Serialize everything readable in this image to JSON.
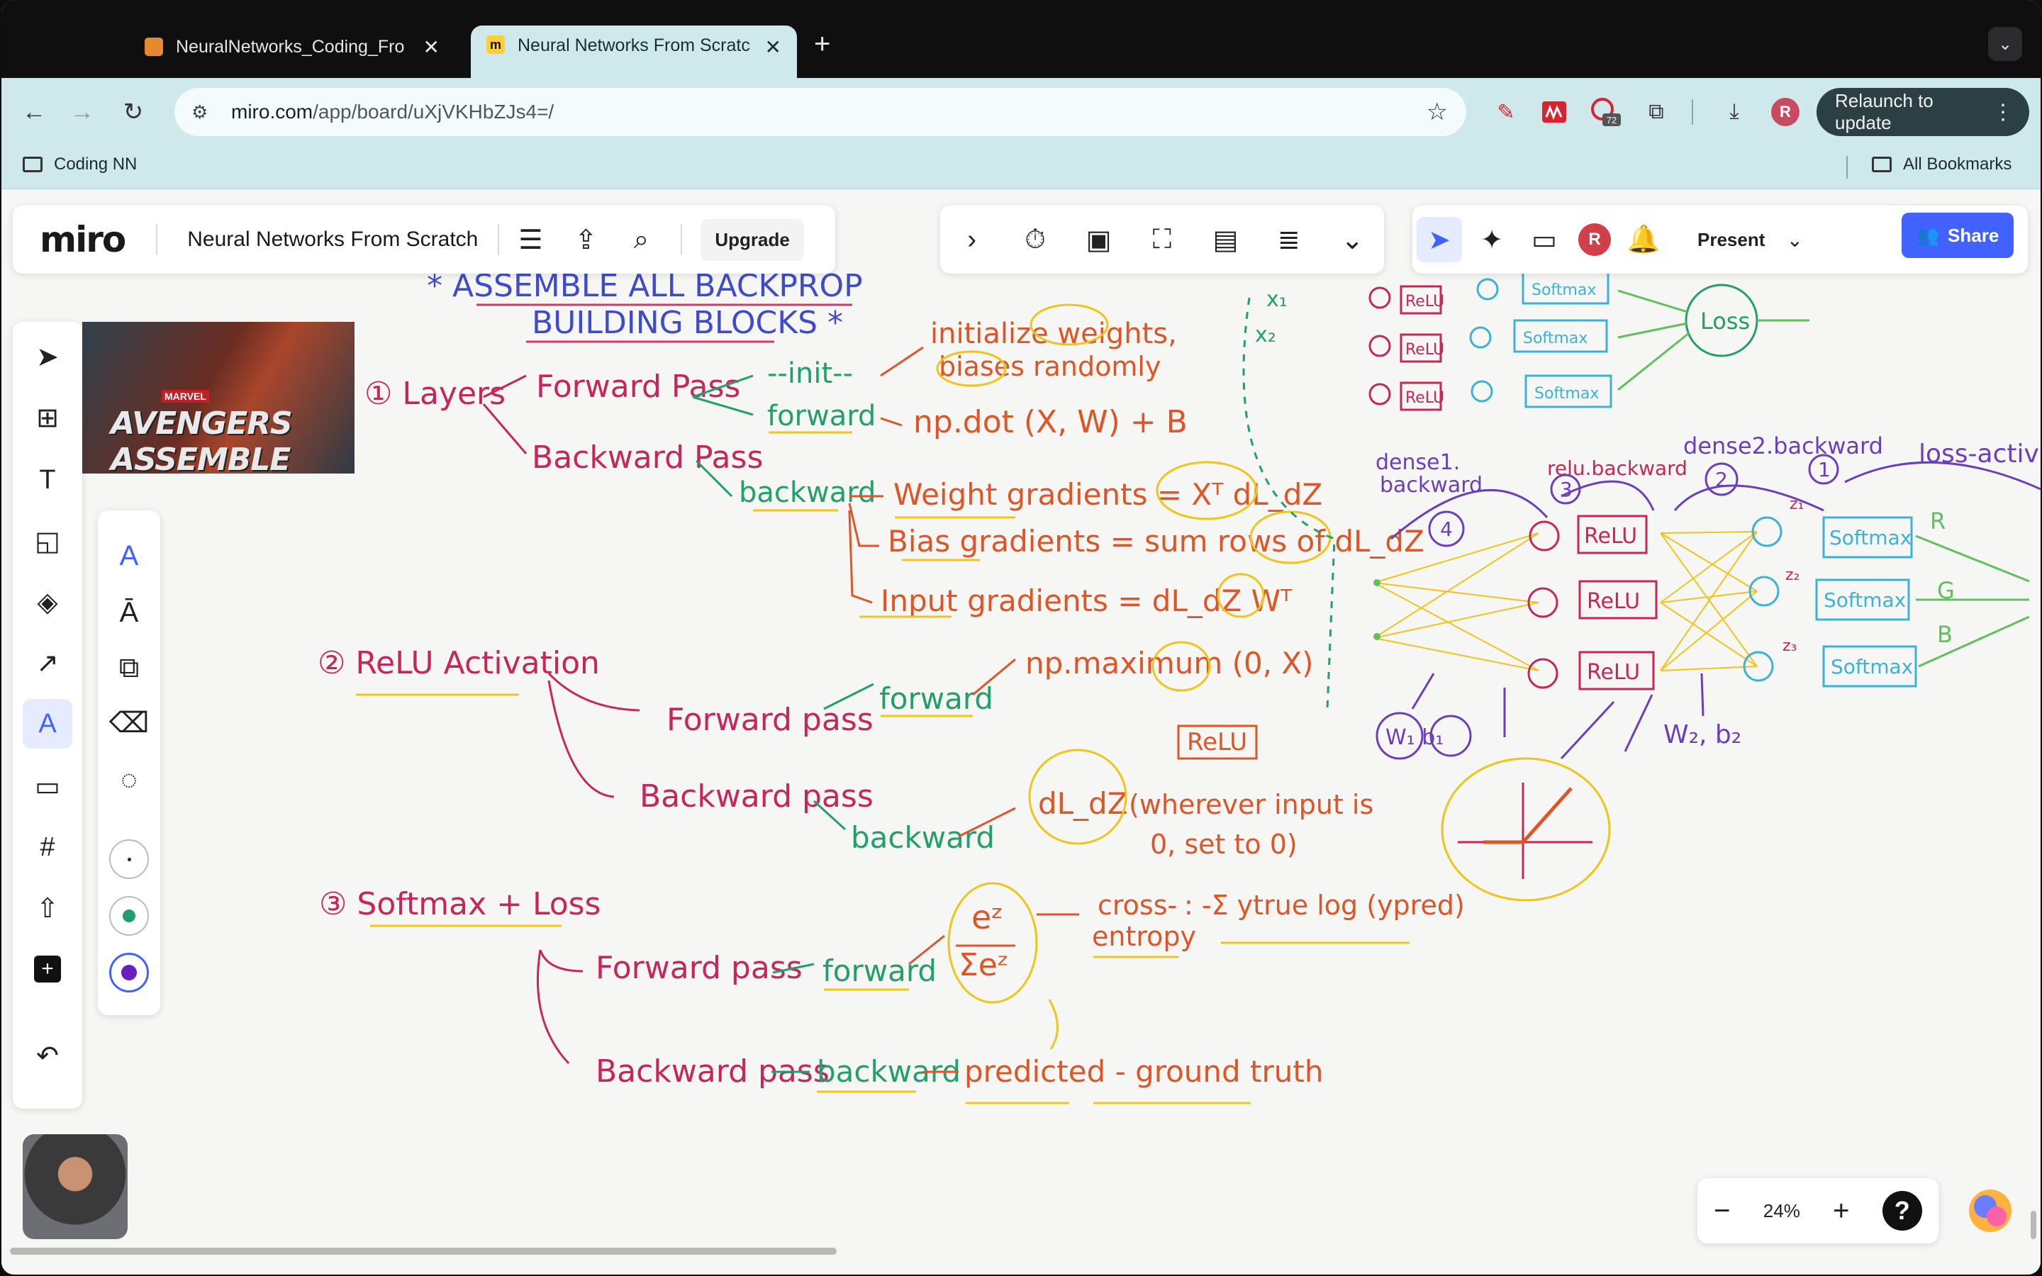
{
  "browser": {
    "tabs": [
      {
        "title": "NeuralNetworks_Coding_Fro",
        "active": false
      },
      {
        "title": "Neural Networks From Scratc",
        "active": true
      }
    ],
    "url_host": "miro.com",
    "url_path": "/app/board/uXjVKHbZJs4=/",
    "extension_badge": "72",
    "profile_initial": "R",
    "relaunch_label": "Relaunch to update",
    "bookmarks": {
      "left": "Coding NN",
      "right": "All Bookmarks"
    }
  },
  "miro": {
    "logo": "miro",
    "board_title": "Neural Networks From Scratch",
    "upgrade_label": "Upgrade",
    "present_label": "Present",
    "share_label": "Share",
    "user_initial": "R",
    "zoom_level": "24%",
    "thumbnail": {
      "badge": "MARVEL",
      "title": "AVENGERS ASSEMBLE"
    },
    "accent": "#4262ff"
  },
  "board": {
    "heading": [
      "* ASSEMBLE ALL BACKPROP",
      "BUILDING BLOCKS *"
    ],
    "s1": {
      "title": "① Layers",
      "forward_pass": "Forward Pass",
      "backward_pass": "Backward Pass",
      "init": "--init--",
      "init_note": [
        "initialize weights,",
        "biases randomly"
      ],
      "forward": "forward",
      "forward_eq": "np.dot (X, W) + B",
      "backward": "backward",
      "wgrad": "Weight gradients = Xᵀ dL_dZ",
      "bgrad": "Bias gradients = sum rows of dL_dZ",
      "igrad": "Input gradients = dL_dZ Wᵀ"
    },
    "s2": {
      "title": "② ReLU Activation",
      "forward_pass": "Forward pass",
      "forward": "forward",
      "forward_eq": "np.maximum (0, X)",
      "relu_box": "ReLU",
      "backward_pass": "Backward pass",
      "backward": "backward",
      "backward_eq": "dL_dZ",
      "backward_note": [
        "(wherever input is",
        "0, set to 0)"
      ]
    },
    "s3": {
      "title": "③ Softmax + Loss",
      "forward_pass": "Forward pass",
      "forward": "forward",
      "softmax_top": "eᶻ",
      "softmax_bottom": "Σeᶻ",
      "ce": [
        "cross-",
        "entropy"
      ],
      "ce_eq": ": -Σ ytrue log (ypred)",
      "backward_pass": "Backward pass",
      "backward": "backward",
      "backward_eq": "predicted - ground truth"
    },
    "network": {
      "inputs": [
        "x₁",
        "x₂"
      ],
      "relu": "ReLU",
      "softmax": "Softmax",
      "loss": "Loss",
      "outputs": [
        "R",
        "G",
        "B"
      ],
      "z_labels": [
        "z₁",
        "z₂",
        "z₃"
      ],
      "dense1_backward": [
        "dense1.",
        "backward"
      ],
      "relu_backward": "relu.backward",
      "dense2_backward": "dense2.backward",
      "loss_activation": "loss-activati",
      "steps": [
        "4",
        "3",
        "2",
        "1"
      ],
      "w1b1": "W₁ b₁",
      "w2b2": "W₂, b₂"
    }
  }
}
